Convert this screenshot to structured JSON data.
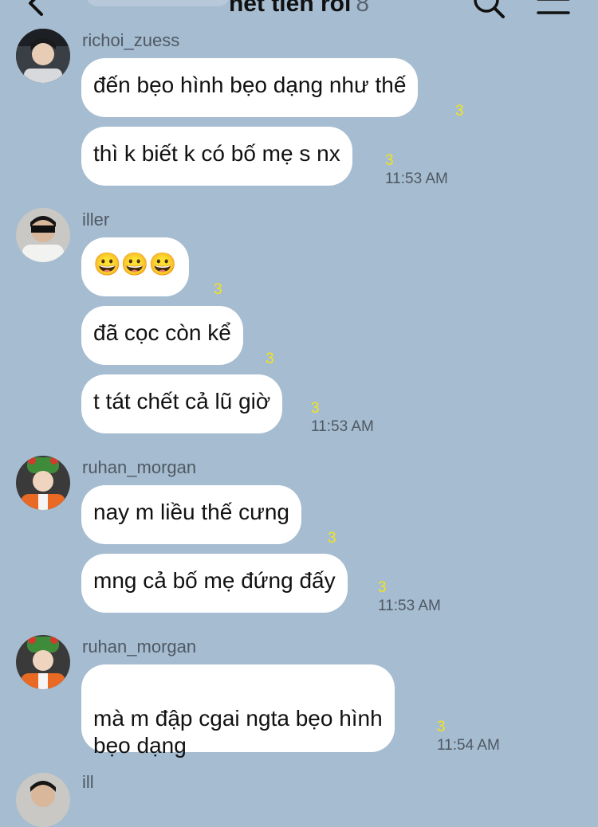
{
  "header": {
    "title": "hết tiền rồi",
    "member_count": "8"
  },
  "groups": [
    {
      "sender": "richoi_zuess",
      "avatar": "user-avatar-photo",
      "messages": [
        {
          "text": "đến bẹo hình bẹo dạng như thế",
          "unread": "3"
        },
        {
          "text": "thì k biết k có bố mẹ s nx",
          "unread": "3",
          "time": "11:53 AM"
        }
      ]
    },
    {
      "sender": "iller",
      "avatar": "user-avatar-photo",
      "messages": [
        {
          "text": "😀😀😀",
          "unread": "3"
        },
        {
          "text": "đã cọc còn kể",
          "unread": "3"
        },
        {
          "text": "t tát chết cả lũ giờ",
          "unread": "3",
          "time": "11:53 AM"
        }
      ]
    },
    {
      "sender": "ruhan_morgan",
      "avatar": "user-avatar-photo",
      "messages": [
        {
          "text": "nay m liều thế cưng",
          "unread": "3"
        },
        {
          "text": "mng cả bố mẹ đứng đấy",
          "unread": "3",
          "time": "11:53 AM"
        }
      ]
    },
    {
      "sender": "ruhan_morgan",
      "avatar": "user-avatar-photo",
      "messages": [
        {
          "text": "mà m đập cgai ngta bẹo hình\nbẹo dạng",
          "unread": "3",
          "time": "11:54 AM"
        }
      ]
    },
    {
      "sender": "ill",
      "avatar": "user-avatar-photo"
    }
  ]
}
